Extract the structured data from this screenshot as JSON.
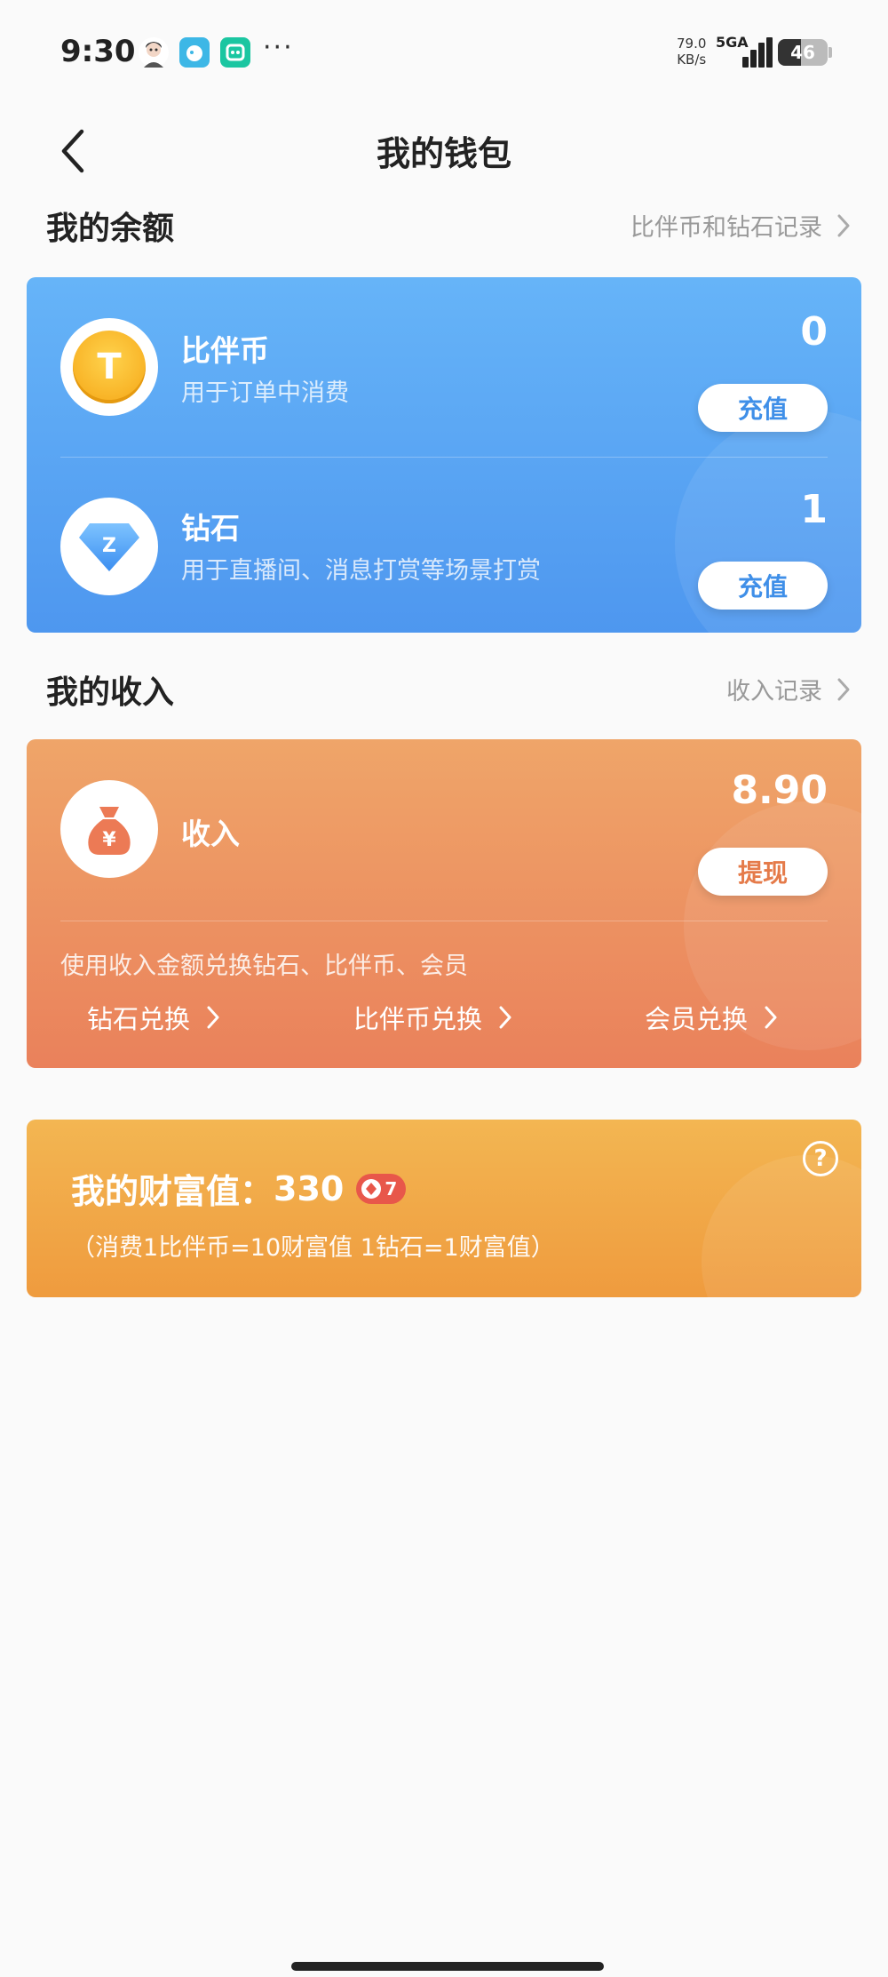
{
  "status_bar": {
    "time": "9:30",
    "net_speed_value": "79.0",
    "net_speed_unit": "KB/s",
    "network": "5GA",
    "battery": "46",
    "battery_level": 0.46,
    "icons": [
      "avatar-icon",
      "blue-app-icon",
      "green-app-icon",
      "more-dots"
    ]
  },
  "header": {
    "title": "我的钱包",
    "back_icon": "chevron-left-icon"
  },
  "balance": {
    "section_title": "我的余额",
    "record_link": "比伴币和钻石记录",
    "items": [
      {
        "name": "比伴币",
        "desc": "用于订单中消费",
        "value": "0",
        "button": "充值",
        "icon": "coin-icon",
        "icon_letter": "T"
      },
      {
        "name": "钻石",
        "desc": "用于直播间、消息打赏等场景打赏",
        "value": "1",
        "button": "充值",
        "icon": "diamond-icon",
        "icon_letter": "Z"
      }
    ]
  },
  "income": {
    "section_title": "我的收入",
    "record_link": "收入记录",
    "name": "收入",
    "value": "8.90",
    "button": "提现",
    "icon": "money-bag-icon",
    "icon_symbol": "¥",
    "tip": "使用收入金额兑换钻石、比伴币、会员",
    "exchanges": [
      {
        "label": "钻石兑换"
      },
      {
        "label": "比伴币兑换"
      },
      {
        "label": "会员兑换"
      }
    ]
  },
  "wealth": {
    "title_prefix": "我的财富值：",
    "value": "330",
    "badge_level": "7",
    "note": "（消费1比伴币=10财富值 1钻石=1财富值）",
    "help_symbol": "?"
  },
  "colors": {
    "balance_card": "#5aa5f3",
    "income_card": "#ec9462",
    "wealth_card": "#f1a848",
    "badge": "#e8574a"
  }
}
